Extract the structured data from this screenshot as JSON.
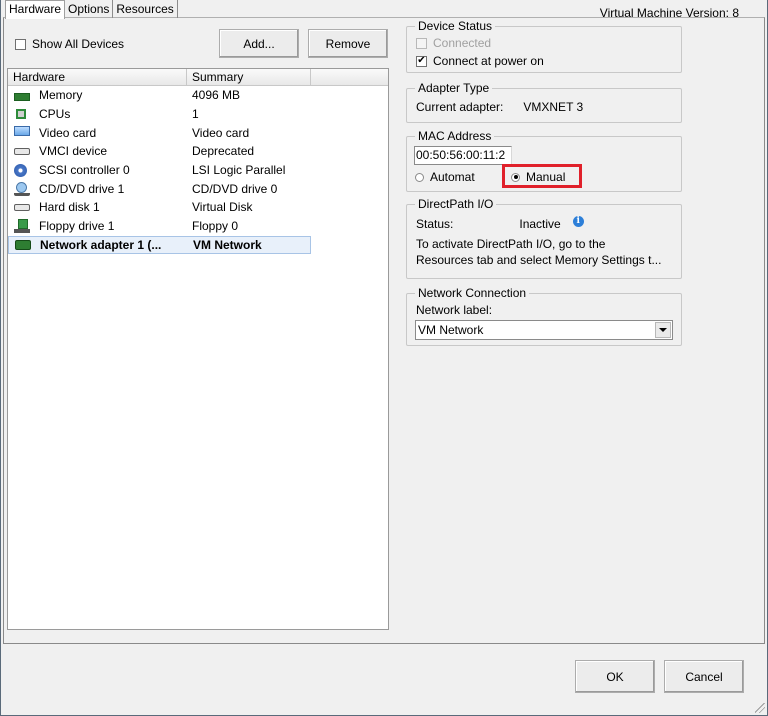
{
  "tabs": [
    {
      "label": "Hardware",
      "active": true
    },
    {
      "label": "Options",
      "active": false
    },
    {
      "label": "Resources",
      "active": false
    }
  ],
  "vm_version": "Virtual Machine Version: 8",
  "left": {
    "show_all_devices": {
      "label": "Show All Devices",
      "checked": false
    },
    "add_button": "Add...",
    "remove_button": "Remove",
    "columns": [
      "Hardware",
      "Summary"
    ],
    "rows": [
      {
        "icon": "memory-icon",
        "hardware": "Memory",
        "summary": "4096 MB"
      },
      {
        "icon": "cpu-icon",
        "hardware": "CPUs",
        "summary": "1"
      },
      {
        "icon": "video-card-icon",
        "hardware": "Video card",
        "summary": "Video card"
      },
      {
        "icon": "vmci-device-icon",
        "hardware": "VMCI device",
        "summary": "Deprecated"
      },
      {
        "icon": "scsi-controller-icon",
        "hardware": "SCSI controller 0",
        "summary": "LSI Logic Parallel"
      },
      {
        "icon": "cd-dvd-drive-icon",
        "hardware": "CD/DVD drive 1",
        "summary": "CD/DVD drive 0"
      },
      {
        "icon": "hard-disk-icon",
        "hardware": "Hard disk 1",
        "summary": "Virtual Disk"
      },
      {
        "icon": "floppy-drive-icon",
        "hardware": "Floppy drive 1",
        "summary": "Floppy 0"
      },
      {
        "icon": "network-adapter-icon",
        "hardware": "Network adapter 1 (...",
        "summary": "VM Network",
        "selected": true
      }
    ]
  },
  "device_status": {
    "title": "Device Status",
    "connected": {
      "label": "Connected",
      "checked": false,
      "disabled": true
    },
    "connect_at_power_on": {
      "label": "Connect at power on",
      "checked": true
    }
  },
  "adapter_type": {
    "title": "Adapter Type",
    "label": "Current adapter:",
    "value": "VMXNET 3"
  },
  "mac_address": {
    "title": "MAC Address",
    "value": "00:50:56:00:11:2",
    "automatic_label": "Automat",
    "manual_label": "Manual",
    "selected": "Manual",
    "highlight_color": "#e0202a"
  },
  "directpath": {
    "title": "DirectPath I/O",
    "status_label": "Status:",
    "status_value": "Inactive",
    "message_line1": "To activate DirectPath I/O, go to the",
    "message_line2": "Resources tab and select Memory Settings t..."
  },
  "network_connection": {
    "title": "Network Connection",
    "label": "Network label:",
    "selected": "VM Network"
  },
  "footer": {
    "ok": "OK",
    "cancel": "Cancel"
  }
}
